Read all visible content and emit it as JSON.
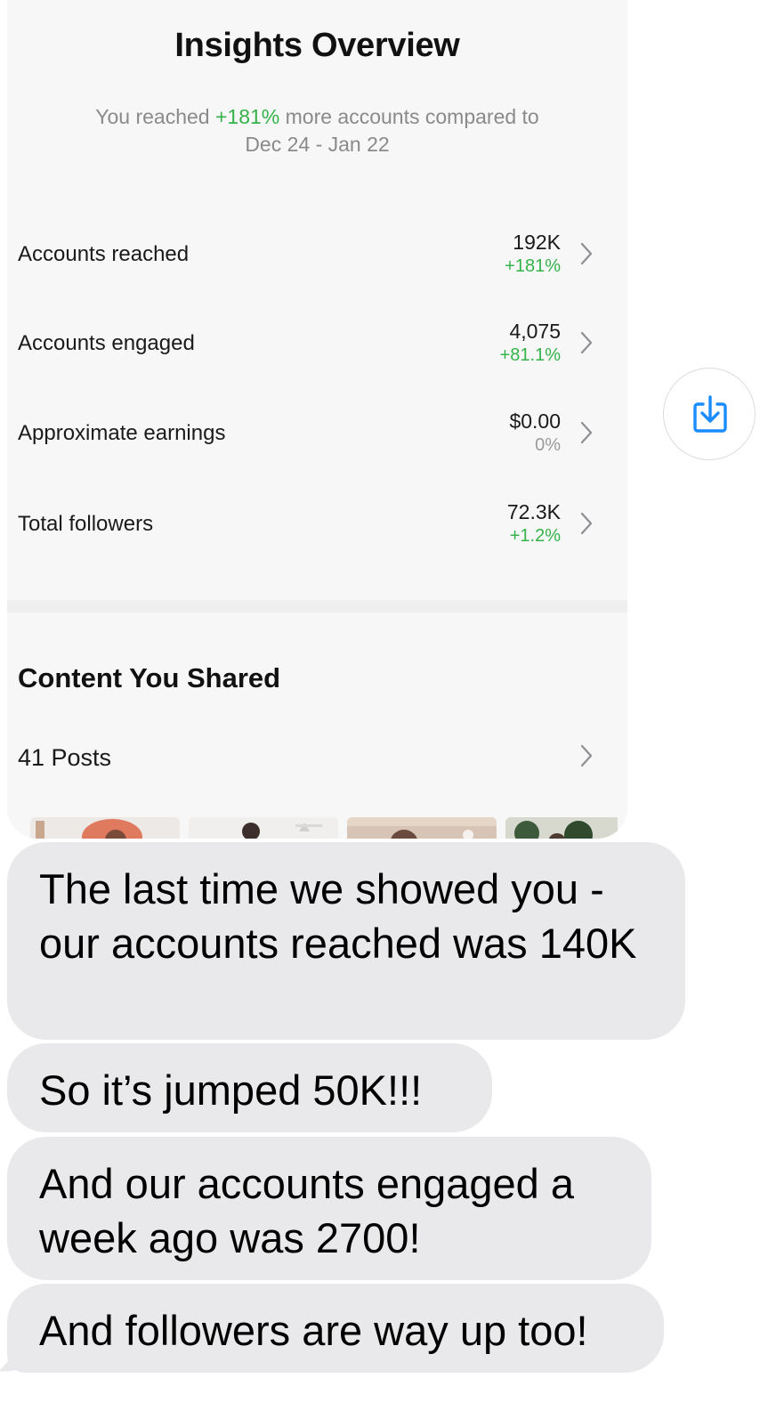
{
  "shared_card": {
    "title": "Insights Overview",
    "subtitle_prefix": "You reached ",
    "subtitle_highlight": "+181%",
    "subtitle_suffix": " more accounts compared to",
    "subtitle_dates": "Dec 24 - Jan 22",
    "metrics": [
      {
        "label": "Accounts reached",
        "value": "192K",
        "change": "+181%"
      },
      {
        "label": "Accounts engaged",
        "value": "4,075",
        "change": "+81.1%"
      },
      {
        "label": "Approximate earnings",
        "value": "$0.00",
        "change": "0%"
      },
      {
        "label": "Total followers",
        "value": "72.3K",
        "change": "+1.2%"
      }
    ],
    "content_section_title": "Content You Shared",
    "posts_label": "41 Posts"
  },
  "colors": {
    "positive": "#35b24a",
    "bubble": "#e9e9eb",
    "share_icon": "#1a8cff"
  },
  "share_button": {
    "icon": "download-share-icon"
  },
  "messages": [
    "The last time we showed you - our accounts reached was 140K",
    "So it’s jumped 50K!!!",
    "And our accounts engaged a week ago was 2700!",
    "And followers are way up too!"
  ]
}
